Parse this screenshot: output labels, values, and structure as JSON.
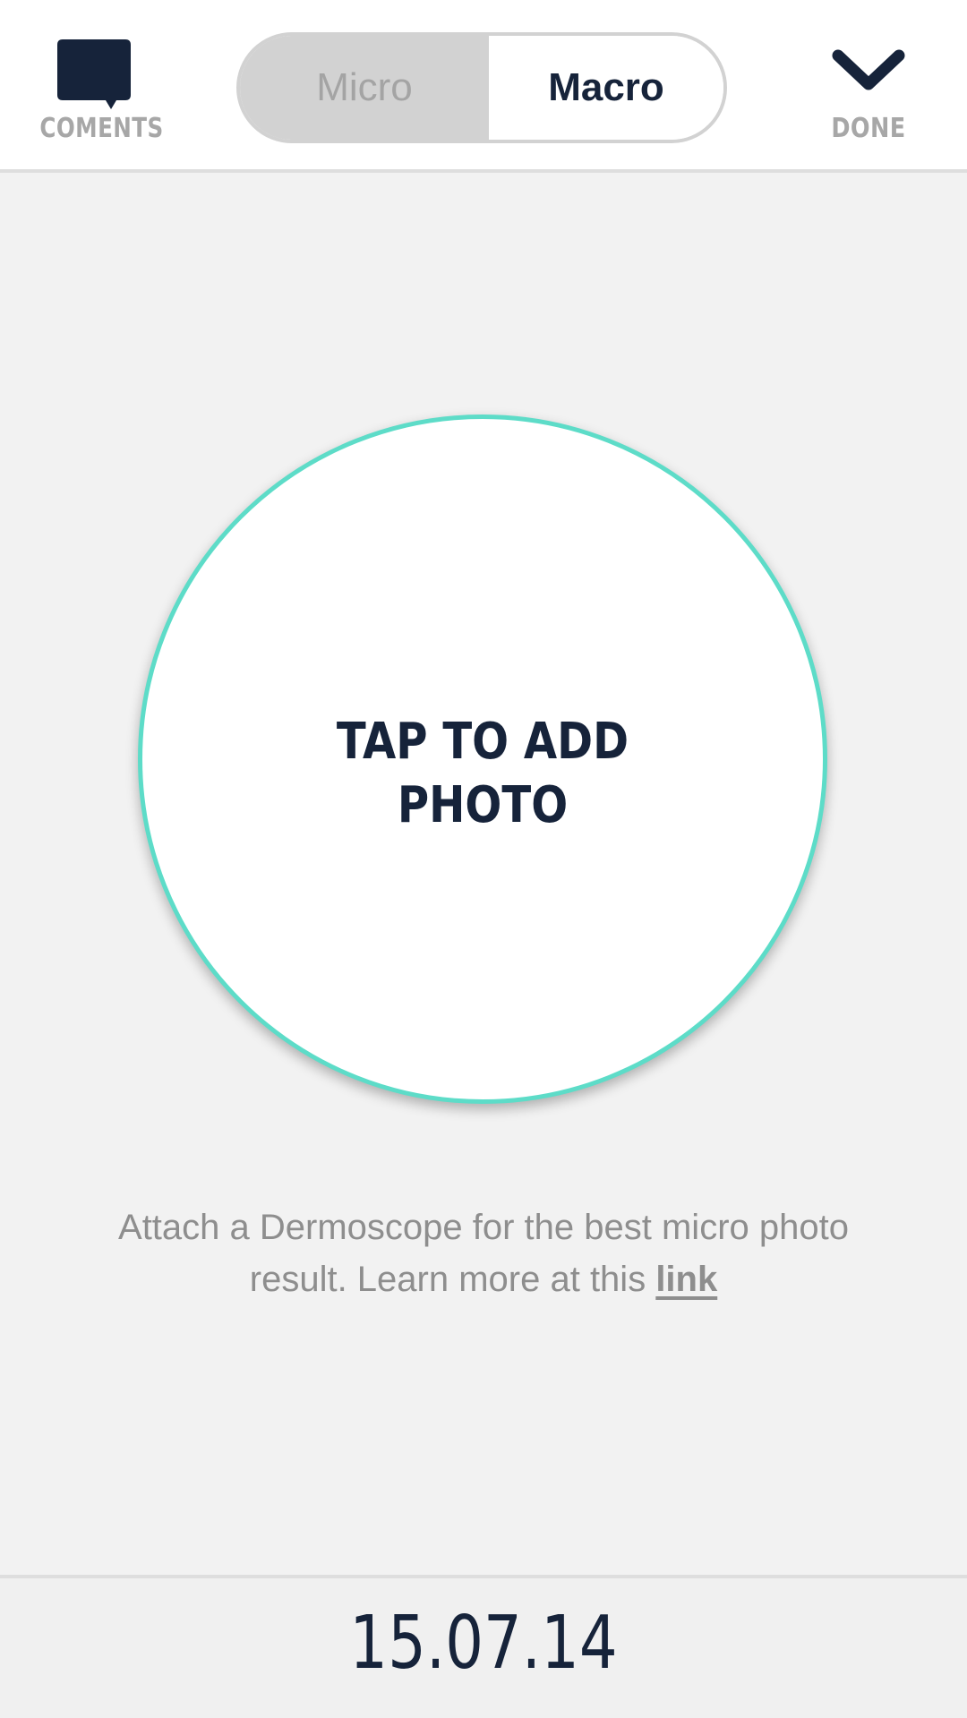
{
  "header": {
    "comments_label": "COMENTS",
    "comments_icon": "speech-bubble-icon",
    "segment": {
      "options": [
        "Micro",
        "Macro"
      ],
      "selected": "Macro"
    },
    "done_label": "DONE",
    "done_icon": "chevron-down-icon"
  },
  "photo": {
    "cta": "TAP TO ADD\nPHOTO"
  },
  "hint": {
    "text": "Attach a Dermoscope for the best micro photo result. Learn more at this ",
    "link_label": "link"
  },
  "footer": {
    "date": "15.07.14"
  },
  "colors": {
    "navy": "#16233a",
    "accent": "#5ddcc8",
    "muted": "#a7a7a7",
    "background": "#f2f2f2"
  }
}
